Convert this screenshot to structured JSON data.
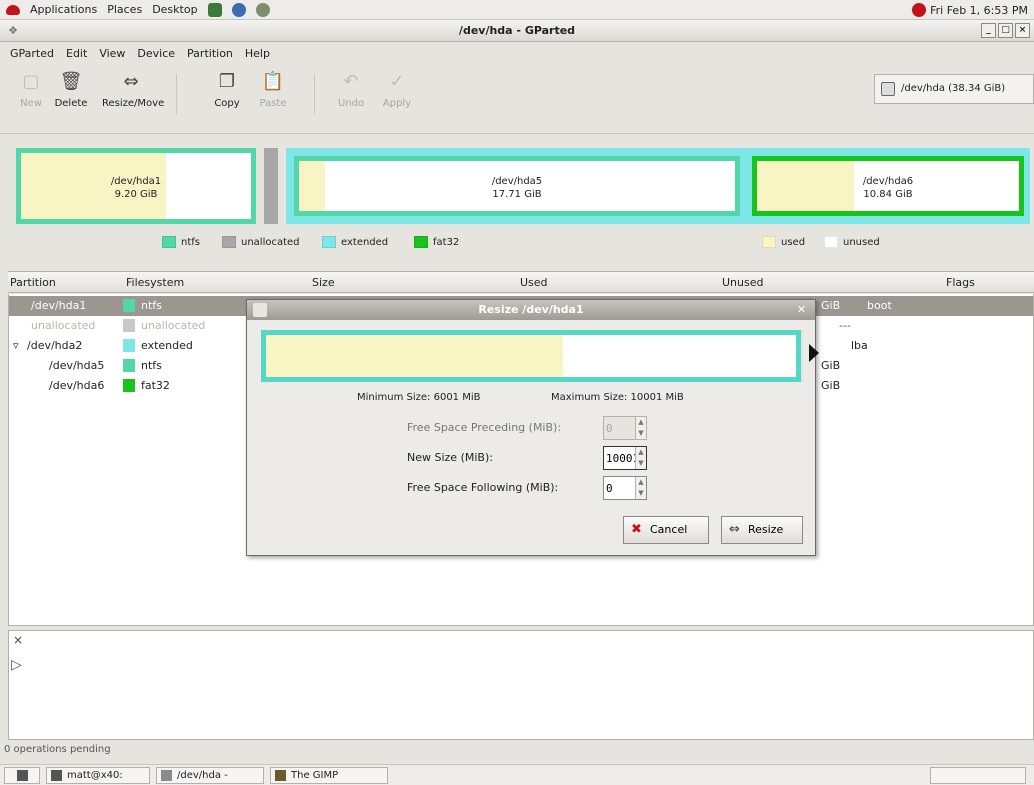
{
  "panel": {
    "menus": [
      "Applications",
      "Places",
      "Desktop"
    ],
    "clock": "Fri Feb 1, 6:53 PM"
  },
  "window": {
    "title": "/dev/hda - GParted"
  },
  "menubar": [
    "GParted",
    "Edit",
    "View",
    "Device",
    "Partition",
    "Help"
  ],
  "toolbar": {
    "new": "New",
    "delete": "Delete",
    "resize_move": "Resize/Move",
    "copy": "Copy",
    "paste": "Paste",
    "undo": "Undo",
    "apply": "Apply",
    "device": "/dev/hda (38.34 GiB)"
  },
  "partition_map": {
    "hda1": {
      "name": "/dev/hda1",
      "size": "9.20 GiB",
      "used_fraction": 0.63
    },
    "hda5": {
      "name": "/dev/hda5",
      "size": "17.71 GiB",
      "used_fraction": 0.06
    },
    "hda6": {
      "name": "/dev/hda6",
      "size": "10.84 GiB",
      "used_fraction": 0.37
    }
  },
  "legend": {
    "ntfs": "ntfs",
    "unallocated": "unallocated",
    "extended": "extended",
    "fat32": "fat32",
    "used": "used",
    "unused": "unused"
  },
  "columns": {
    "partition": "Partition",
    "filesystem": "Filesystem",
    "size": "Size",
    "used": "Used",
    "unused": "Unused",
    "flags": "Flags"
  },
  "rows": [
    {
      "partition": "/dev/hda1",
      "filesystem": "ntfs",
      "unused": "GiB",
      "flags": "boot"
    },
    {
      "partition": "unallocated",
      "filesystem": "unallocated",
      "unused": "",
      "flags": "---"
    },
    {
      "partition": "/dev/hda2",
      "filesystem": "extended",
      "unused": "",
      "flags": "lba"
    },
    {
      "partition": "/dev/hda5",
      "filesystem": "ntfs",
      "unused": "GiB",
      "flags": ""
    },
    {
      "partition": "/dev/hda6",
      "filesystem": "fat32",
      "unused": "GiB",
      "flags": ""
    }
  ],
  "status": "0 operations pending",
  "taskbar": {
    "items": [
      "matt@x40:",
      "/dev/hda -",
      "The GIMP"
    ]
  },
  "dialog": {
    "title": "Resize /dev/hda1",
    "used_fraction": 0.56,
    "min_size": "Minimum Size: 6001 MiB",
    "max_size": "Maximum Size: 10001 MiB",
    "free_preceding_label": "Free Space Preceding (MiB):",
    "free_preceding_value": "0",
    "new_size_label": "New Size (MiB):",
    "new_size_value": "10001",
    "free_following_label": "Free Space Following (MiB):",
    "free_following_value": "0",
    "cancel": "Cancel",
    "resize": "Resize"
  },
  "colors": {
    "ntfs": "#53d7a8",
    "unallocated": "#a7a7a7",
    "extended": "#7ee6e6",
    "fat32": "#19c31e",
    "used": "#f8f4c4",
    "unused": "#ffffff"
  }
}
